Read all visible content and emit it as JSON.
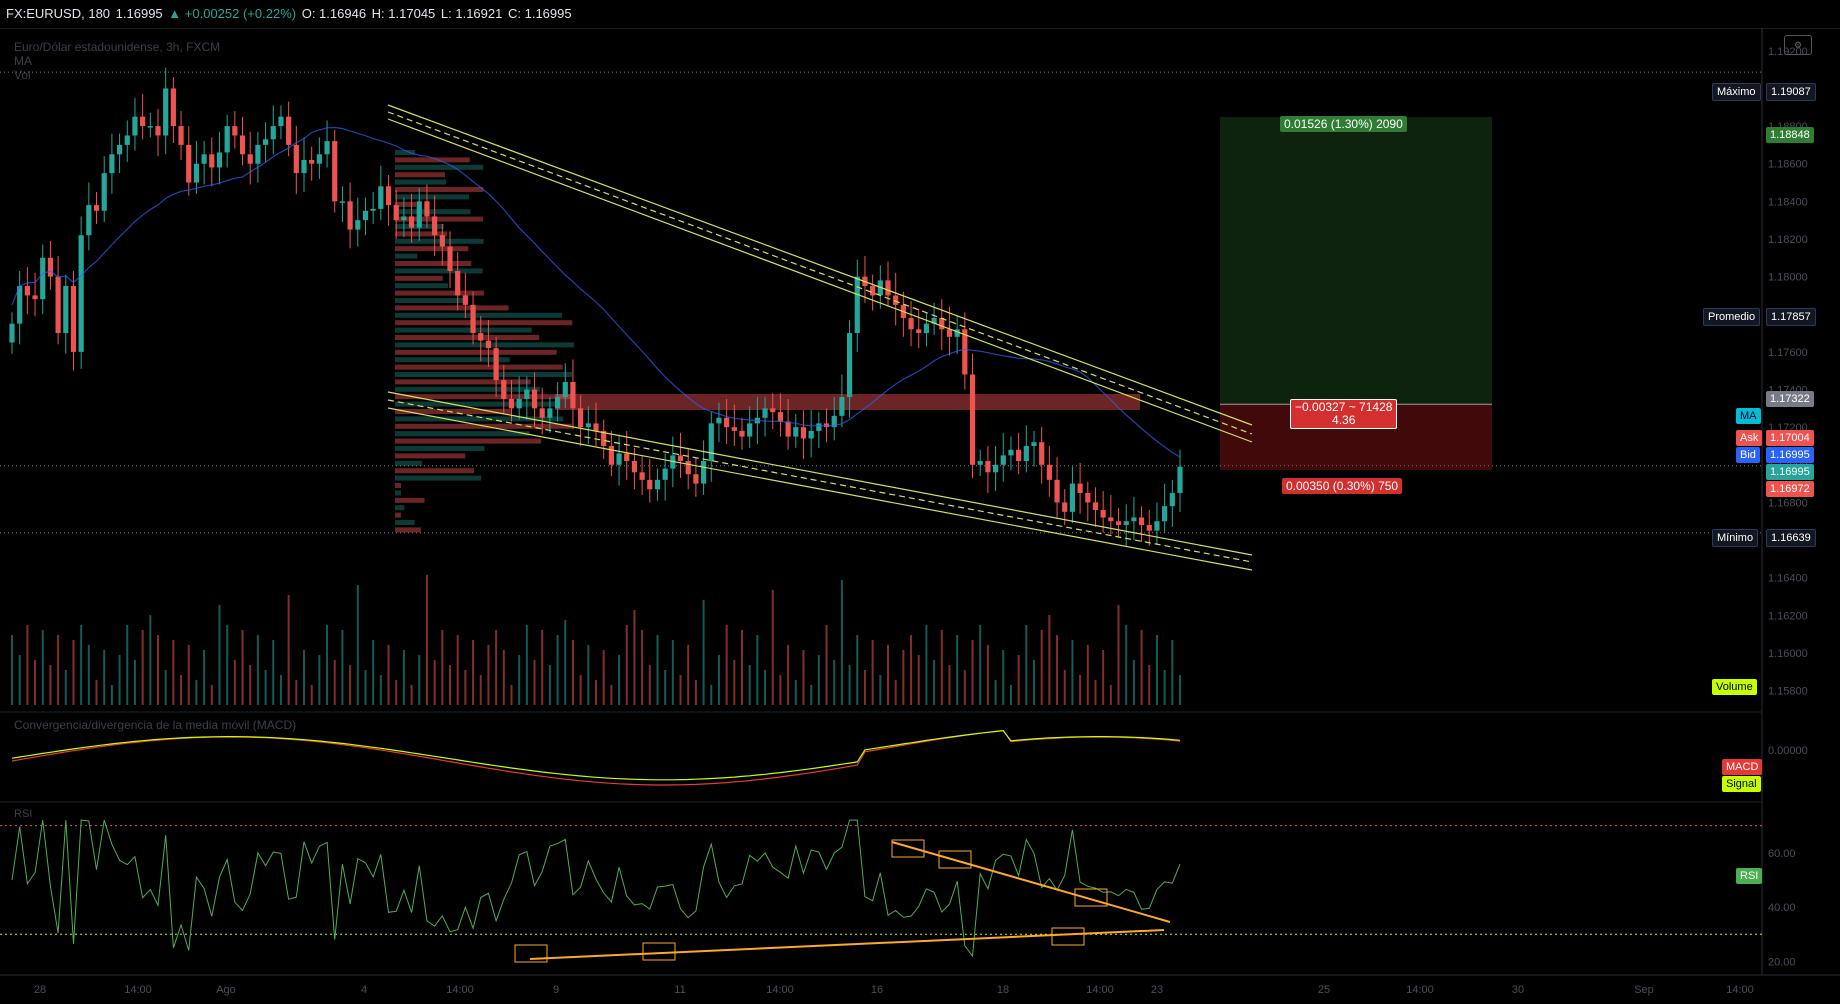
{
  "header": {
    "symbol": "FX:EURUSD, 180",
    "last": "1.16995",
    "change": "▲ +0.00252 (+0.22%)",
    "open": "O: 1.16946",
    "high": "H: 1.17045",
    "low": "L: 1.16921",
    "close": "C: 1.16995"
  },
  "legend": {
    "title": "Euro/Dólar estadounidense, 3h, FXCM",
    "ma": "MA",
    "vol": "Vol",
    "macd": "Convergencia/divergencia de la media móvil (MACD)",
    "rsi": "RSI"
  },
  "axis": {
    "price_ticks": [
      "1.19200",
      "1.19000",
      "1.18800",
      "1.18600",
      "1.18400",
      "1.18200",
      "1.18000",
      "1.17800",
      "1.17600",
      "1.17400",
      "1.17200",
      "1.17000",
      "1.16800",
      "1.16600",
      "1.16400",
      "1.16200",
      "1.16000",
      "1.15800"
    ],
    "macd_ticks": [
      "0.00000"
    ],
    "rsi_ticks": [
      "60.00",
      "40.00",
      "20.00"
    ],
    "time_ticks": [
      "28",
      "14:00",
      "Ago",
      "4",
      "14:00",
      "9",
      "11",
      "14:00",
      "16",
      "18",
      "14:00",
      "23",
      "25",
      "14:00",
      "30",
      "Sep",
      "14:00"
    ]
  },
  "tags": {
    "max_label": "Máximo",
    "max_value": "1.19087",
    "tp_value": "1.18848",
    "avg_label": "Promedio",
    "avg_value": "1.17857",
    "entry_value": "1.17322",
    "ma_label": "MA",
    "ask_label": "Ask",
    "ask_value": "1.17004",
    "bid_label": "Bid",
    "bid_value": "1.16995",
    "price_value": "1.16995",
    "sl_value": "1.16972",
    "min_label": "Mínimo",
    "min_value": "1.16639",
    "volume_label": "Volume",
    "macd_label": "MACD",
    "signal_label": "Signal",
    "rsi_label": "RSI"
  },
  "position": {
    "target_text": "0.01526 (1.30%) 2090",
    "risk_line1": "−0.00327 ~ 71428",
    "risk_line2": "4.36",
    "stop_text": "0.00350 (0.30%) 750"
  },
  "colors": {
    "up": "#26a69a",
    "down": "#ef5350",
    "channel": "#d4e157",
    "ma": "#2962ff",
    "rsi": "#4caf50",
    "trend": "#ffa726"
  },
  "chart_data": {
    "type": "candlestick",
    "title": "Euro/Dólar estadounidense, 3h, FXCM",
    "ylim": [
      1.1575,
      1.193
    ],
    "close": [
      1.1775,
      1.1795,
      1.179,
      1.1788,
      1.181,
      1.18,
      1.177,
      1.1795,
      1.176,
      1.1822,
      1.1838,
      1.1835,
      1.1855,
      1.1865,
      1.187,
      1.1875,
      1.1885,
      1.188,
      1.188,
      1.1875,
      1.19,
      1.188,
      1.187,
      1.185,
      1.186,
      1.1865,
      1.1858,
      1.1866,
      1.188,
      1.1875,
      1.1865,
      1.186,
      1.187,
      1.1873,
      1.188,
      1.1885,
      1.187,
      1.1855,
      1.1862,
      1.186,
      1.1865,
      1.1872,
      1.184,
      1.184,
      1.1825,
      1.183,
      1.1835,
      1.1836,
      1.1848,
      1.1838,
      1.183,
      1.1832,
      1.1826,
      1.184,
      1.1832,
      1.1822,
      1.1816,
      1.1803,
      1.179,
      1.1785,
      1.177,
      1.1766,
      1.1762,
      1.1745,
      1.1735,
      1.173,
      1.1735,
      1.174,
      1.173,
      1.1725,
      1.173,
      1.1736,
      1.1744,
      1.173,
      1.172,
      1.1722,
      1.1718,
      1.171,
      1.17,
      1.1706,
      1.1702,
      1.1696,
      1.1692,
      1.1687,
      1.1692,
      1.1698,
      1.1705,
      1.1702,
      1.1695,
      1.169,
      1.1702,
      1.1722,
      1.1725,
      1.172,
      1.1718,
      1.1715,
      1.1722,
      1.1725,
      1.173,
      1.1728,
      1.1723,
      1.1715,
      1.172,
      1.1714,
      1.1718,
      1.1722,
      1.172,
      1.1726,
      1.1736,
      1.177,
      1.18,
      1.1795,
      1.179,
      1.1798,
      1.179,
      1.1785,
      1.1778,
      1.1772,
      1.177,
      1.1775,
      1.1778,
      1.1772,
      1.1768,
      1.1772,
      1.1748,
      1.17,
      1.1702,
      1.1696,
      1.17,
      1.1705,
      1.1708,
      1.1702,
      1.171,
      1.1712,
      1.17,
      1.1692,
      1.168,
      1.1675,
      1.169,
      1.1685,
      1.168,
      1.1676,
      1.1672,
      1.167,
      1.1668,
      1.167,
      1.1672,
      1.1668,
      1.1665,
      1.167,
      1.1678,
      1.1685,
      1.1699
    ]
  }
}
